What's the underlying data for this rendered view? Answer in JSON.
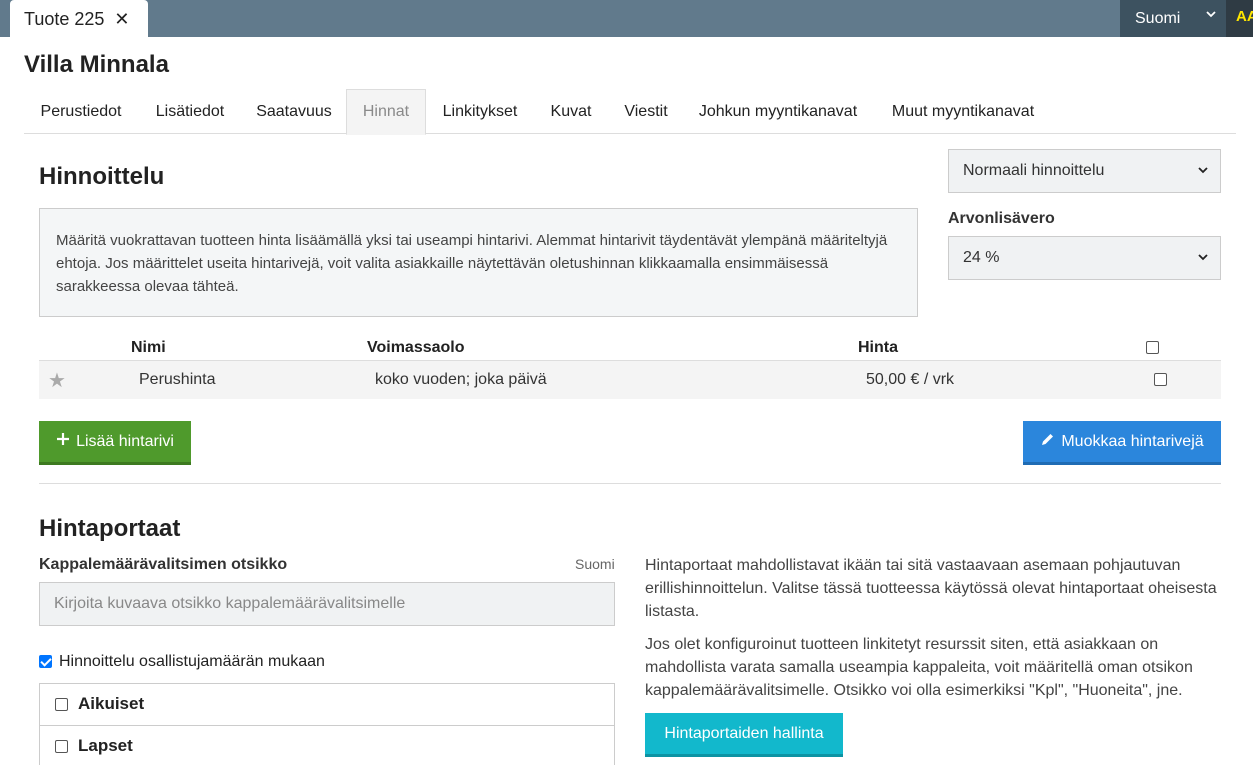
{
  "window_tab": {
    "title": "Tuote 225",
    "close": "✕"
  },
  "language": {
    "selected": "Suomi"
  },
  "user": {
    "initials": "AA"
  },
  "page": {
    "title": "Villa Minnala"
  },
  "tabs": [
    {
      "label": "Perustiedot"
    },
    {
      "label": "Lisätiedot"
    },
    {
      "label": "Saatavuus"
    },
    {
      "label": "Hinnat"
    },
    {
      "label": "Linkitykset"
    },
    {
      "label": "Kuvat"
    },
    {
      "label": "Viestit"
    },
    {
      "label": "Johkun myyntikanavat"
    },
    {
      "label": "Muut myyntikanavat"
    }
  ],
  "active_tab": "Hinnat",
  "pricing": {
    "heading": "Hinnoittelu",
    "info": "Määritä vuokrattavan tuotteen hinta lisäämällä yksi tai useampi hintarivi. Alemmat hintarivit täydentävät ylempänä määriteltyjä ehtoja. Jos määrittelet useita hintarivejä, voit valita asiakkaille näytettävän oletushinnan klikkaamalla ensimmäisessä sarakkeessa olevaa tähteä.",
    "mode_select": "Normaali hinnoittelu",
    "vat_label": "Arvonlisävero",
    "vat_select": "24 %",
    "table": {
      "headers": {
        "name": "Nimi",
        "validity": "Voimassaolo",
        "price": "Hinta"
      },
      "rows": [
        {
          "name": "Perushinta",
          "validity": "koko vuoden; joka päivä",
          "price": "50,00 € / vrk",
          "default": true,
          "selected": false
        }
      ],
      "select_all": false
    },
    "add_button": "Lisää hintarivi",
    "edit_button": "Muokkaa hintarivejä"
  },
  "tiers": {
    "heading": "Hintaportaat",
    "field_label": "Kappalemäärävalitsimen otsikko",
    "field_language": "Suomi",
    "field_placeholder": "Kirjoita kuvaava otsikko kappalemäärävalitsimelle",
    "participant_pricing_label": "Hinnoittelu osallistujamäärän mukaan",
    "participant_pricing_checked": true,
    "groups": [
      {
        "label": "Aikuiset",
        "checked": false
      },
      {
        "label": "Lapset",
        "checked": false
      }
    ],
    "info_1": "Hintaportaat mahdollistavat ikään tai sitä vastaavaan asemaan pohjautuvan erillishinnoittelun. Valitse tässä tuotteessa käytössä olevat hintaportaat oheisesta listasta.",
    "info_2": "Jos olet konfiguroinut tuotteen linkitetyt resurssit siten, että asiakkaan on mahdollista varata samalla useampia kappaleita, voit määritellä oman otsikon kappalemäärävalitsimelle. Otsikko voi olla esimerkiksi \"Kpl\", \"Huoneita\", jne.",
    "manage_button": "Hintaportaiden hallinta"
  },
  "colors": {
    "topbar": "#617a8c",
    "add_button": "#4f9a2c",
    "edit_button": "#2b86dc",
    "tiers_button": "#12b8cc",
    "user_badge_text": "#ffe600"
  },
  "icons": {
    "close": "close-icon",
    "chevron": "chevron-down-icon",
    "star": "star-icon",
    "plus": "plus-icon",
    "pencil": "pencil-icon"
  }
}
